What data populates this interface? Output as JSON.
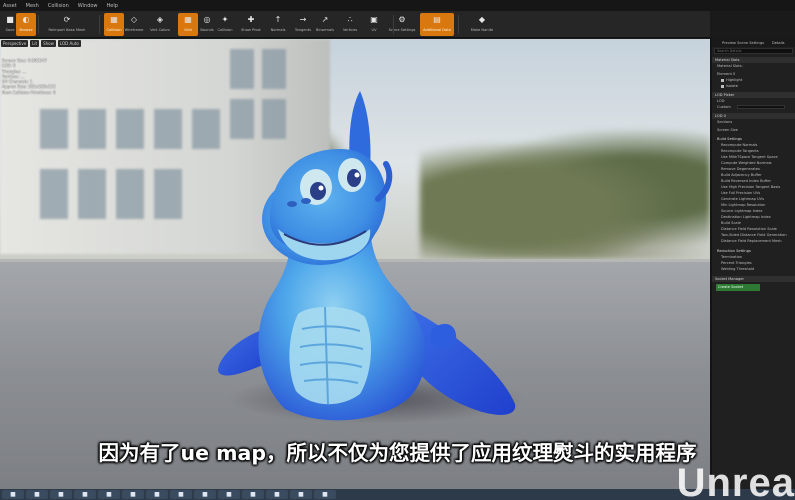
{
  "menu": [
    "Asset",
    "Mesh",
    "Collision",
    "Window",
    "Help"
  ],
  "toolbar": [
    {
      "label": "Save",
      "icon": "save-icon",
      "glyph": "■",
      "active": false
    },
    {
      "label": "Browse",
      "icon": "folder-icon",
      "glyph": "◐",
      "active": true
    },
    {
      "label": "Reimport Base Mesh",
      "icon": "reimport-icon",
      "glyph": "⟳",
      "active": false
    },
    {
      "label": "Collision",
      "icon": "collision-icon",
      "glyph": "▦",
      "active": true
    },
    {
      "label": "Wireframe",
      "icon": "wireframe-icon",
      "glyph": "◇",
      "active": false
    },
    {
      "label": "Vert Colors",
      "icon": "vert-colors-icon",
      "glyph": "◈",
      "active": false
    },
    {
      "label": "Grid",
      "icon": "grid-icon",
      "glyph": "▦",
      "active": true
    },
    {
      "label": "Bounds",
      "icon": "bounds-icon",
      "glyph": "◎",
      "active": false
    },
    {
      "label": "Collision",
      "icon": "collision-view-icon",
      "glyph": "✦",
      "active": false
    },
    {
      "label": "Show Pivot",
      "icon": "pivot-icon",
      "glyph": "✚",
      "active": false
    },
    {
      "label": "Normals",
      "icon": "normals-icon",
      "glyph": "↑",
      "active": false
    },
    {
      "label": "Tangents",
      "icon": "tangents-icon",
      "glyph": "→",
      "active": false
    },
    {
      "label": "Binormals",
      "icon": "binormals-icon",
      "glyph": "↗",
      "active": false
    },
    {
      "label": "Vertices",
      "icon": "vertices-icon",
      "glyph": "∴",
      "active": false
    },
    {
      "label": "UV",
      "icon": "uv-icon",
      "glyph": "▣",
      "active": false
    },
    {
      "label": "Scene Settings",
      "icon": "scene-settings-icon",
      "glyph": "⚙",
      "active": false
    },
    {
      "label": "Additional Data",
      "icon": "additional-data-icon",
      "glyph": "▤",
      "active": true
    },
    {
      "label": "Make Nanite",
      "icon": "nanite-icon",
      "glyph": "◆",
      "active": false
    }
  ],
  "viewport": {
    "hud": [
      "Perspective",
      "Lit",
      "Show",
      "LOD Auto"
    ],
    "stats": [
      "Screen Size: 0.902347",
      "LOD: 0",
      "Triangles: ...",
      "Vertices: ...",
      "UV Channels: 1",
      "Approx Size: 281x183x151",
      "Num Collision Primitives: 0"
    ]
  },
  "panel": {
    "tabs": [
      "Preview Scene Settings",
      "Details"
    ],
    "search_placeholder": "Search Details",
    "sections": {
      "material_slots": "Material Slots",
      "material_slots_rows": [
        "Material Slots:"
      ],
      "element": "Element 0",
      "element_checks": [
        "Highlight",
        "Isolate"
      ],
      "lod_picker": "LOD Picker",
      "lod_row": "LOD",
      "lod_value": "Custom",
      "lod0": "LOD 0",
      "sections_row": "Sections",
      "screen_size": "Screen Size",
      "build_settings": "Build Settings",
      "build_rows": [
        "Recompute Normals",
        "Recompute Tangents",
        "Use MikkTSpace Tangent Space",
        "Compute Weighted Normals",
        "Remove Degenerates",
        "Build Adjacency Buffer",
        "Build Reversed Index Buffer",
        "Use High Precision Tangent Basis",
        "Use Full Precision UVs",
        "Generate Lightmap UVs",
        "Min Lightmap Resolution",
        "Source Lightmap Index",
        "Destination Lightmap Index",
        "Build Scale",
        "Distance Field Resolution Scale",
        "Two-Sided Distance Field Generation",
        "Distance Field Replacement Mesh"
      ],
      "reduction_settings": "Reduction Settings",
      "reduction_rows": [
        "Termination",
        "Percent Triangles",
        "Welding Threshold"
      ],
      "socket_manager": "Socket Manager",
      "create_socket": "Create Socket"
    }
  },
  "subtitle": "因为有了ue map，所以不仅为您提供了应用纹理熨斗的实用程序",
  "watermark": "Unrea",
  "taskbar_icons": [
    "start-icon",
    "ie-icon",
    "explorer-icon",
    "chrome-icon",
    "media-icon",
    "settings-icon",
    "app-icon",
    "photoshop-icon",
    "game-icon",
    "unreal-icon",
    "premiere-icon",
    "browser-icon",
    "misc-icon",
    "misc-icon"
  ],
  "colors": {
    "accent": "#d9780e",
    "dragon_body": "#3c8fe6",
    "dragon_dark": "#2850d0",
    "panel_bg": "#202020",
    "create_button": "#2e7a34"
  }
}
